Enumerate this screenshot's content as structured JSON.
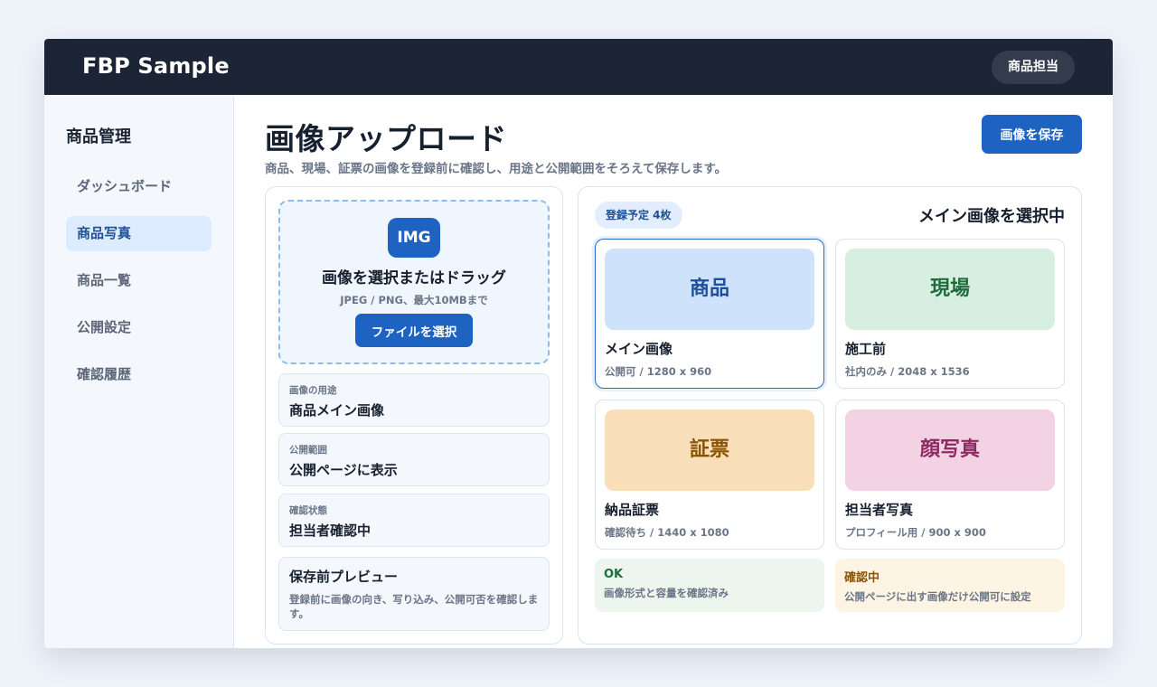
{
  "header": {
    "brand": "FBP Sample",
    "role": "商品担当"
  },
  "sidebar": {
    "title": "商品管理",
    "items": [
      {
        "label": "ダッシュボード",
        "active": false
      },
      {
        "label": "商品写真",
        "active": true
      },
      {
        "label": "商品一覧",
        "active": false
      },
      {
        "label": "公開設定",
        "active": false
      },
      {
        "label": "確認履歴",
        "active": false
      }
    ]
  },
  "page": {
    "title": "画像アップロード",
    "subtitle": "商品、現場、証票の画像を登録前に確認し、用途と公開範囲をそろえて保存します。",
    "save_label": "画像を保存"
  },
  "upload": {
    "badge": "IMG",
    "title": "画像を選択またはドラッグ",
    "hint": "JPEG / PNG、最大10MBまで",
    "button": "ファイルを選択"
  },
  "fields": [
    {
      "label": "画像の用途",
      "value": "商品メイン画像"
    },
    {
      "label": "公開範囲",
      "value": "公開ページに表示"
    },
    {
      "label": "確認状態",
      "value": "担当者確認中"
    }
  ],
  "preview": {
    "title": "保存前プレビュー",
    "description": "登録前に画像の向き、写り込み、公開可否を確認します。"
  },
  "gallery": {
    "count_badge": "登録予定 4枚",
    "title": "メイン画像を選択中",
    "cards": [
      {
        "thumb_label": "商品",
        "name": "メイン画像",
        "meta": "公開可 / 1280 x 960",
        "selected": true,
        "thumb_bg": "#cfe2fb",
        "thumb_color": "#1f4f98"
      },
      {
        "thumb_label": "現場",
        "name": "施工前",
        "meta": "社内のみ / 2048 x 1536",
        "selected": false,
        "thumb_bg": "#d6efe0",
        "thumb_color": "#1f6b3c"
      },
      {
        "thumb_label": "証票",
        "name": "納品証票",
        "meta": "確認待ち / 1440 x 1080",
        "selected": false,
        "thumb_bg": "#f8dfba",
        "thumb_color": "#8a5300"
      },
      {
        "thumb_label": "顔写真",
        "name": "担当者写真",
        "meta": "プロフィール用 / 900 x 900",
        "selected": false,
        "thumb_bg": "#f3d2e4",
        "thumb_color": "#8e2a62"
      }
    ]
  },
  "statuses": [
    {
      "title": "OK",
      "description": "画像形式と容量を確認済み",
      "bg": "#ecf6ef",
      "color": "#1f6b3c"
    },
    {
      "title": "確認中",
      "description": "公開ページに出す画像だけ公開可に設定",
      "bg": "#fdf4e3",
      "color": "#8a5300"
    }
  ]
}
